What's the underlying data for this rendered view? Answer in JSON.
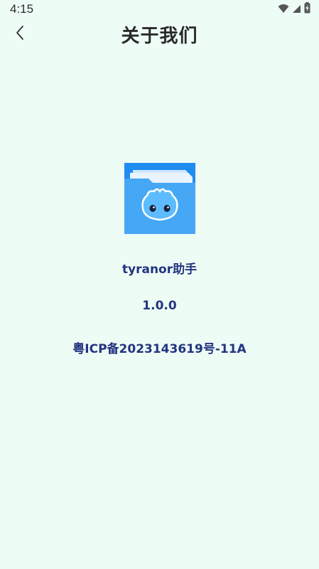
{
  "status_bar": {
    "time": "4:15",
    "icons": [
      "wifi-icon",
      "signal-icon",
      "battery-charging-icon"
    ]
  },
  "header": {
    "title": "关于我们",
    "back_icon": "chevron-left-icon"
  },
  "app": {
    "logo_icon": "folder-mascot-icon",
    "name": "tyranor助手",
    "version": "1.0.0",
    "icp": "粤ICP备2023143619号-11A"
  },
  "colors": {
    "background": "#eefcf6",
    "info_text": "#23357f",
    "logo_blue": "#1f8cf0",
    "title_text": "#2a2a2a"
  }
}
